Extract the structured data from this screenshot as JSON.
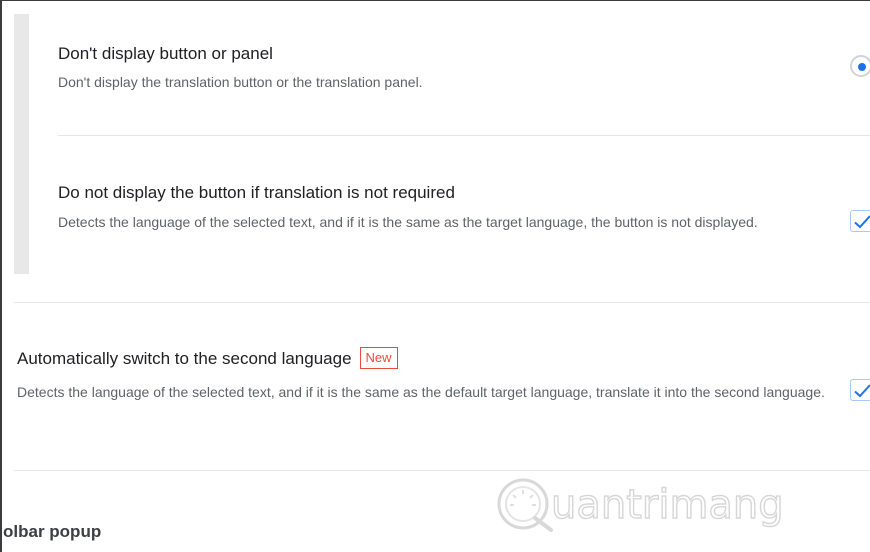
{
  "options": [
    {
      "title": "Don't display button or panel",
      "description": "Don't display the translation button or the translation panel.",
      "control": "radio",
      "selected": true
    },
    {
      "title": "Do not display the button if translation is not required",
      "description": "Detects the language of the selected text, and if it is the same as the target language, the button is not displayed.",
      "control": "checkbox",
      "checked": true
    },
    {
      "title": "Automatically switch to the second language",
      "badge": "New",
      "description": "Detects the language of the selected text, and if it is the same as the default target language, translate it into the second language.",
      "control": "checkbox",
      "checked": true
    }
  ],
  "section_heading": "olbar popup",
  "watermark_text": "uantrimang",
  "colors": {
    "accent": "#1a73e8",
    "badge": "#e84c3d",
    "description": "#5f6368",
    "divider": "#e6e6e6"
  }
}
